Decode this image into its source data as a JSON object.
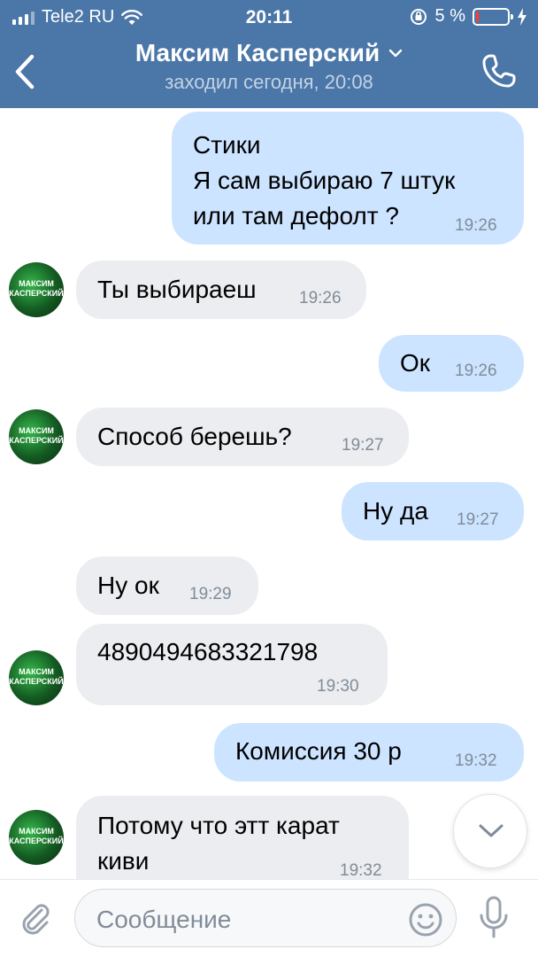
{
  "status_bar": {
    "carrier": "Tele2 RU",
    "time": "20:11",
    "battery_percent": "5 %"
  },
  "header": {
    "contact_name": "Максим Касперский",
    "last_seen": "заходил сегодня, 20:08"
  },
  "avatar_text": "МАКСИМ КАСПЕРСКИЙ",
  "messages": [
    {
      "side": "out",
      "text": "Стики\nЯ сам выбираю 7 штук\nили там дефолт ?",
      "time": "19:26"
    },
    {
      "side": "in",
      "text": "Ты выбираеш",
      "time": "19:26"
    },
    {
      "side": "out",
      "text": "Ок",
      "time": "19:26"
    },
    {
      "side": "in",
      "text": "Способ берешь?",
      "time": "19:27"
    },
    {
      "side": "out",
      "text": "Ну да",
      "time": "19:27"
    },
    {
      "side": "in",
      "text": "Ну ок",
      "time": "19:29"
    },
    {
      "side": "in",
      "text": "4890494683321798",
      "time": "19:30"
    },
    {
      "side": "out",
      "text": "Комиссия 30 р",
      "time": "19:32"
    },
    {
      "side": "in",
      "text": "Потому что этт карат\nкиви",
      "time": "19:32"
    }
  ],
  "composer": {
    "placeholder": "Сообщение"
  },
  "colors": {
    "header_bg": "#4a76a8",
    "outgoing_bubble": "#cce4ff",
    "incoming_bubble": "#ebedf0",
    "time_text": "#818c99"
  },
  "icons": [
    "back-icon",
    "chevron-down-icon",
    "phone-icon",
    "wifi-icon",
    "rotation-lock-icon",
    "charging-icon",
    "attach-icon",
    "emoji-icon",
    "mic-icon",
    "scroll-down-icon"
  ]
}
